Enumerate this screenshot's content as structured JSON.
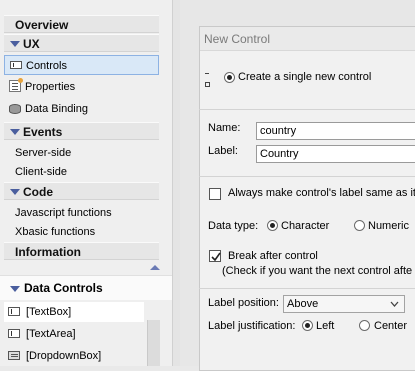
{
  "nav": {
    "overview": "Overview",
    "ux": {
      "header": "UX",
      "items": [
        "Controls",
        "Properties",
        "Data Binding"
      ]
    },
    "events": {
      "header": "Events",
      "items": [
        "Server-side",
        "Client-side"
      ]
    },
    "code": {
      "header": "Code",
      "items": [
        "Javascript functions",
        "Xbasic functions"
      ]
    },
    "information": "Information",
    "data_controls": {
      "header": "Data Controls",
      "items": [
        "[TextBox]",
        "[TextArea]",
        "[DropdownBox]"
      ]
    }
  },
  "dialog": {
    "title": "New Control",
    "create_single_label": "Create a single new control",
    "name_label": "Name:",
    "name_value": "country",
    "label_label": "Label:",
    "label_value": "Country",
    "always_same_label": "Always make control's label same as its",
    "data_type_label": "Data type:",
    "data_type_options": [
      "Character",
      "Numeric"
    ],
    "break_after_label": "Break after control",
    "break_after_hint": "(Check if you want the next control afte",
    "label_position_label": "Label position:",
    "label_position_value": "Above",
    "label_justification_label": "Label justification:",
    "justification_options": [
      "Left",
      "Center"
    ]
  }
}
